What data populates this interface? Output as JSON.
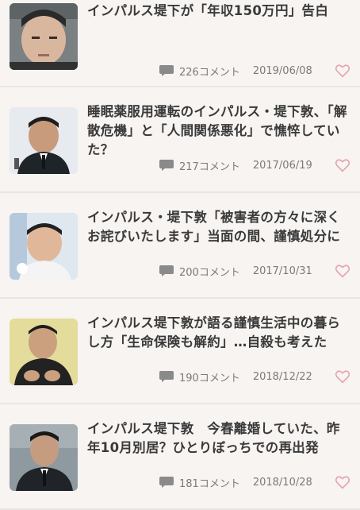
{
  "articles": [
    {
      "title": "インパルス堤下が「年収150万円」告白",
      "comments": "226コメント",
      "date": "2019/06/08"
    },
    {
      "title": "睡眠薬服用運転のインパルス・堤下敦、「解散危機」と「人間関係悪化」で憔悴していた？",
      "comments": "217コメント",
      "date": "2017/06/19"
    },
    {
      "title": "インパルス・堤下敦「被害者の方々に深くお詫びいたします」当面の間、謹慎処分に",
      "comments": "200コメント",
      "date": "2017/10/31"
    },
    {
      "title": "インパルス堤下敦が語る謹慎生活中の暮らし方「生命保険も解約」…自殺も考えた",
      "comments": "190コメント",
      "date": "2018/12/22"
    },
    {
      "title": "インパルス堤下敦　今春離婚していた、昨年10月別居？ひとりぼっちでの再出発",
      "comments": "181コメント",
      "date": "2018/10/28"
    }
  ],
  "colors": {
    "heart": "#e8a3ad",
    "icon": "#8a8a8a",
    "title": "#3a3a3a"
  },
  "icons": {
    "comment": "speech-bubble-icon",
    "favorite": "heart-icon"
  }
}
